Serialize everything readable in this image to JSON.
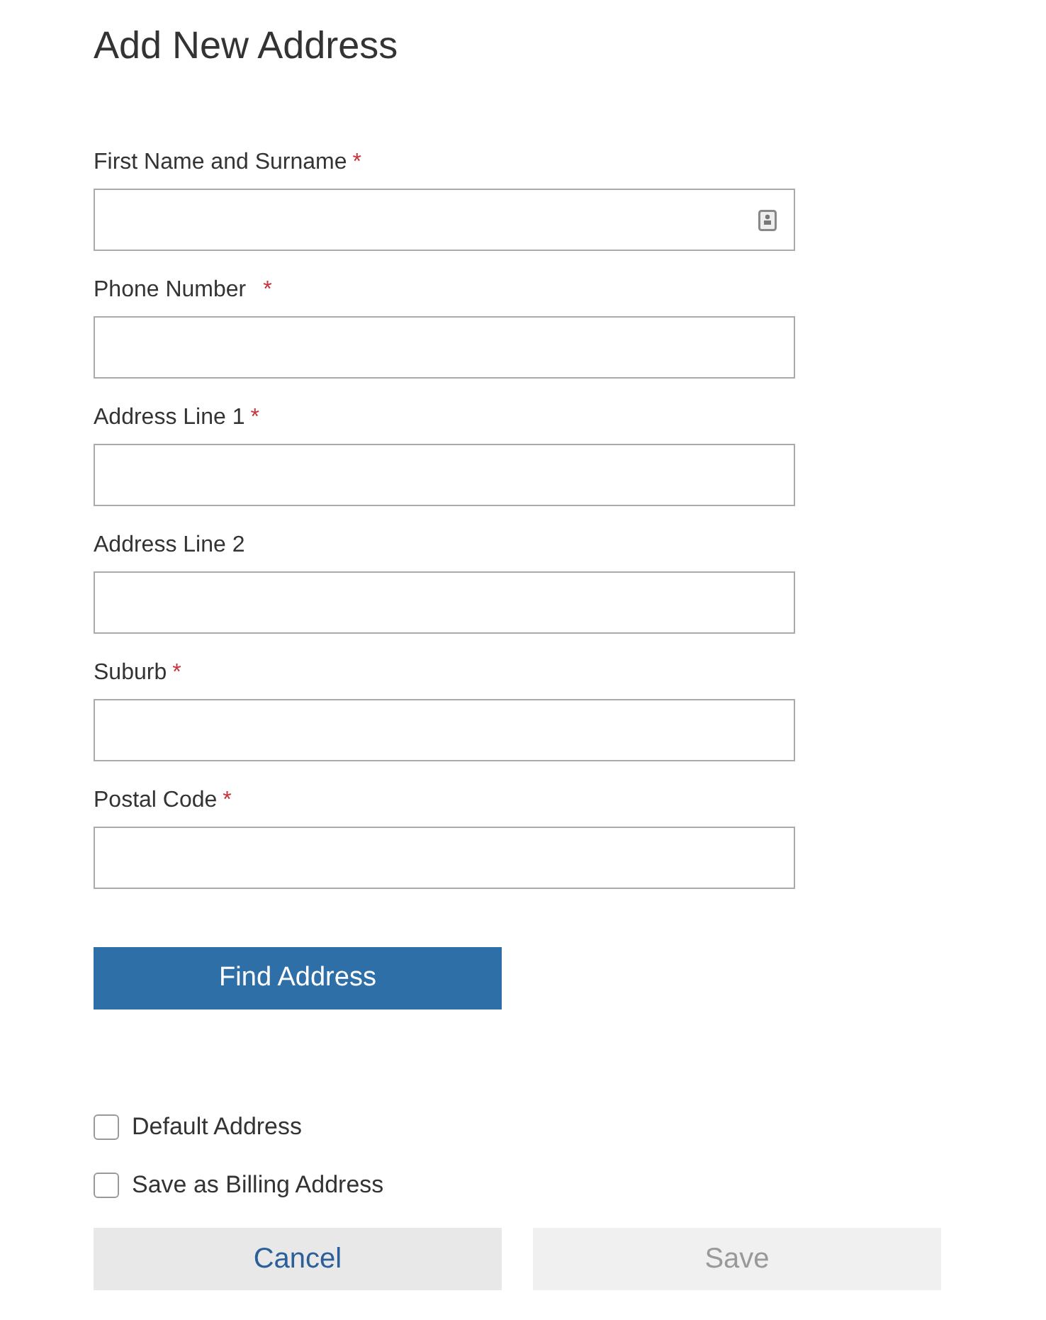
{
  "title": "Add New Address",
  "fields": [
    {
      "label": "First Name and Surname",
      "required_mark": "*",
      "autofill_icon": true
    },
    {
      "label": "Phone Number",
      "required_mark": "*",
      "autofill_icon": false
    },
    {
      "label": "Address Line 1",
      "required_mark": "*",
      "autofill_icon": false
    },
    {
      "label": "Address Line 2",
      "autofill_icon": false
    },
    {
      "label": "Suburb",
      "required_mark": "*",
      "autofill_icon": false
    },
    {
      "label": "Postal Code",
      "required_mark": "*",
      "autofill_icon": false
    }
  ],
  "find_button": "Find Address",
  "checkboxes": [
    {
      "label": "Default Address",
      "checked": false
    },
    {
      "label": "Save as Billing Address",
      "checked": false
    }
  ],
  "buttons": [
    {
      "label": "Cancel",
      "disabled": false
    },
    {
      "label": "Save",
      "disabled": true
    }
  ]
}
